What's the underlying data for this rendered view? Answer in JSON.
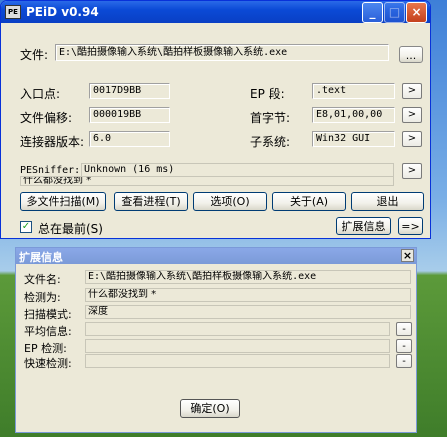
{
  "main": {
    "title": "PEiD v0.94",
    "file_label": "文件:",
    "file_path": "E:\\酷拍摄像输入系统\\酷拍样板摄像输入系统.exe",
    "browse_label": "...",
    "entry_label": "入口点:",
    "entry_value": "0017D9BB",
    "offset_label": "文件偏移:",
    "offset_value": "000019BB",
    "linker_label": "连接器版本:",
    "linker_value": "6.0",
    "ep_section_label": "EP 段:",
    "ep_section_value": ".text",
    "first_bytes_label": "首字节:",
    "first_bytes_value": "E8,01,00,00",
    "subsystem_label": "子系统:",
    "subsystem_value": "Win32 GUI",
    "arrow_label": ">",
    "pesniffer_label": "PESniffer:",
    "pesniffer_value": "Unknown (16 ms)",
    "result_value": "什么都没找到  *",
    "buttons": {
      "multi_scan": "多文件扫描(M)",
      "view_process": "查看进程(T)",
      "options": "选项(O)",
      "about": "关于(A)",
      "exit": "退出"
    },
    "ontop_label": "总在最前(S)",
    "ontop_checked": true,
    "ext_info_label": "扩展信息",
    "ext_arrow_label": "=>"
  },
  "ext": {
    "title": "扩展信息",
    "close_label": "×",
    "file_label": "文件名:",
    "file_value": "E:\\酷拍摄像输入系统\\酷拍样板摄像输入系统.exe",
    "detect_label": "检测为:",
    "detect_value": "什么都没找到  *",
    "mode_label": "扫描模式:",
    "mode_value": "深度",
    "avg_label": "平均信息:",
    "ep_label": "EP 检测:",
    "fast_label": "快速检测:",
    "minus_label": "-",
    "ok_label": "确定(O)"
  }
}
